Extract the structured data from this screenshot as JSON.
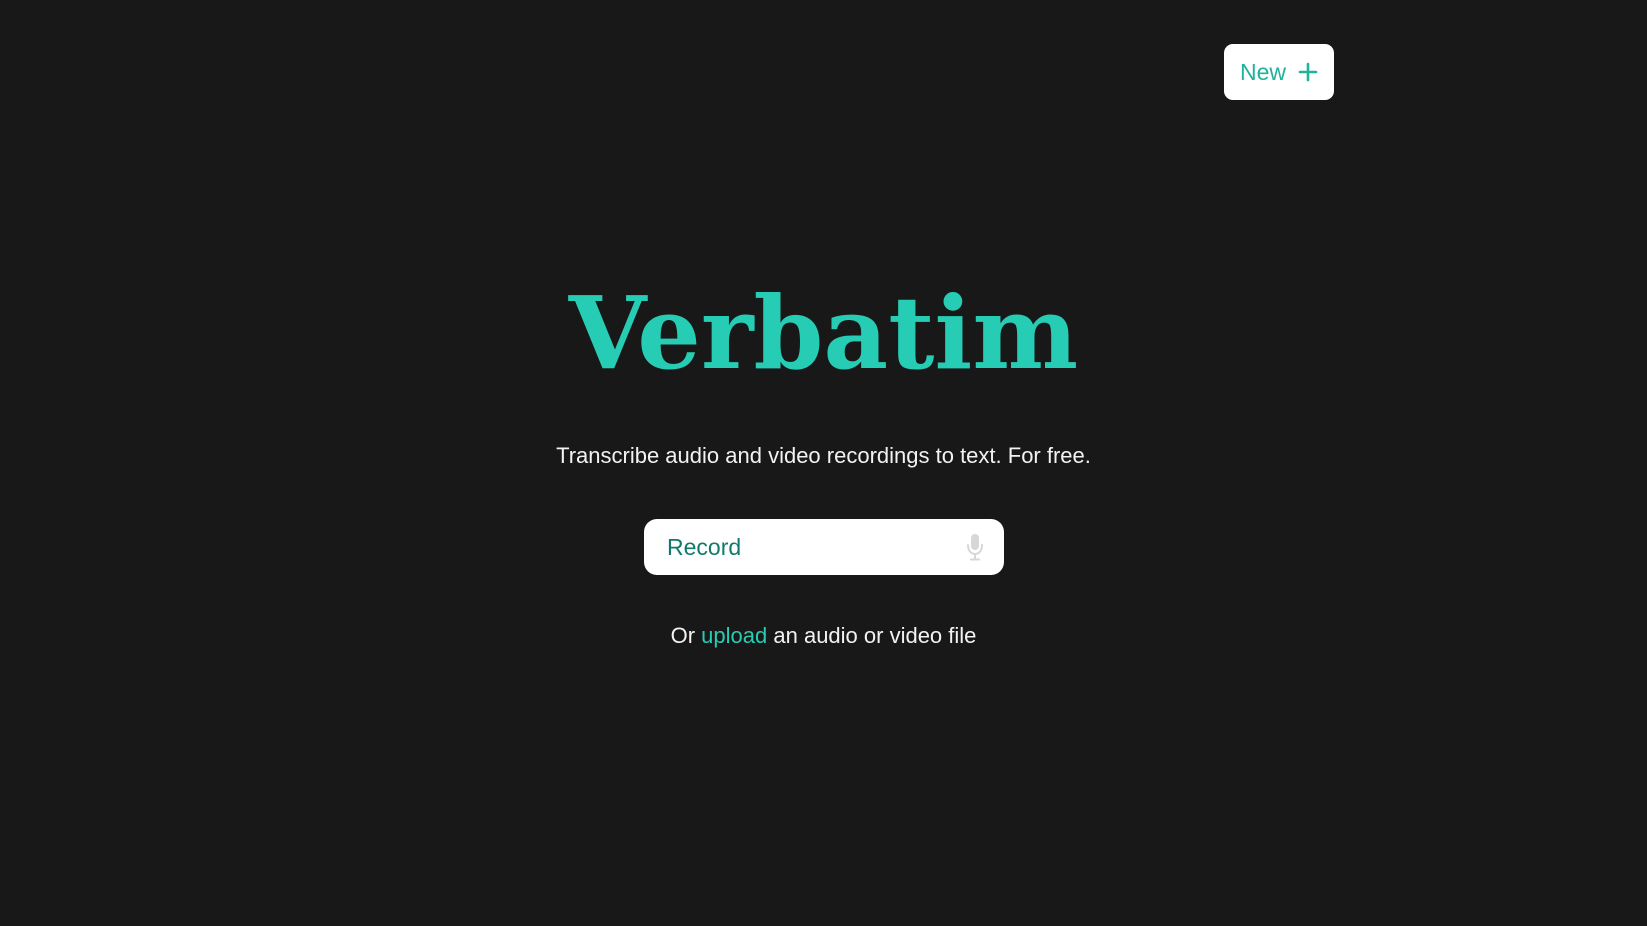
{
  "header": {
    "new_button_label": "New",
    "new_button_icon": "plus-icon"
  },
  "hero": {
    "title": "Verbatim",
    "tagline": "Transcribe audio and video recordings to text. For free."
  },
  "record": {
    "label": "Record",
    "icon": "microphone-icon"
  },
  "upload": {
    "prefix": "Or",
    "link_label": "upload",
    "suffix": "an audio or video file"
  },
  "colors": {
    "background": "#181818",
    "accent": "#27ccb5",
    "text": "#f2f2f2",
    "button_bg": "#ffffff"
  }
}
